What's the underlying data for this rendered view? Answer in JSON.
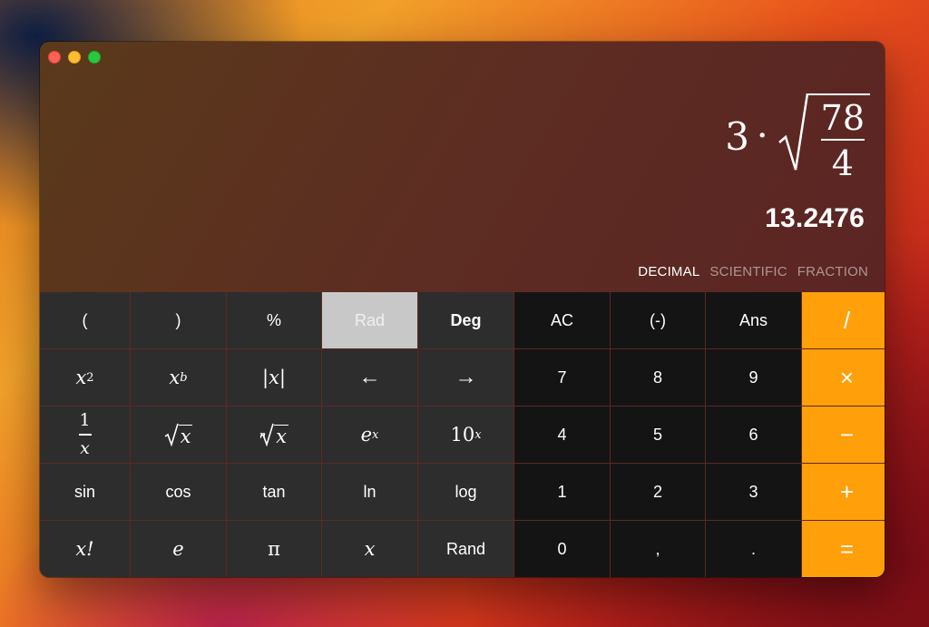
{
  "window": {
    "buttons": [
      "close",
      "minimize",
      "zoom"
    ]
  },
  "display": {
    "expression": {
      "coefficient": "3",
      "operator": "·",
      "numerator": "78",
      "denominator": "4"
    },
    "result": "13.2476",
    "modes": [
      {
        "label": "DECIMAL",
        "active": true
      },
      {
        "label": "SCIENTIFIC",
        "active": false
      },
      {
        "label": "FRACTION",
        "active": false
      }
    ]
  },
  "keys": {
    "lparen": "(",
    "rparen": ")",
    "percent": "%",
    "rad": "Rad",
    "deg": "Deg",
    "ac": "AC",
    "negate": "(-)",
    "ans": "Ans",
    "divide": "/",
    "x_base": "x",
    "sq_exp": "2",
    "pow_exp": "b",
    "abs": "|x|",
    "left_arrow": "←",
    "right_arrow": "→",
    "seven": "7",
    "eight": "8",
    "nine": "9",
    "multiply": "×",
    "one_over_num": "1",
    "one_over_den": "x",
    "sqrt_arg": "x",
    "nroot_index": "n",
    "nroot_arg": "x",
    "exp_base": "e",
    "exp_exp": "x",
    "pow10_base": "10",
    "pow10_exp": "x",
    "four": "4",
    "five": "5",
    "six": "6",
    "minus": "−",
    "sin": "sin",
    "cos": "cos",
    "tan": "tan",
    "ln": "ln",
    "log": "log",
    "one": "1",
    "two": "2",
    "three": "3",
    "plus": "+",
    "factorial": "x!",
    "euler": "e",
    "pi": "π",
    "variable": "x",
    "rand": "Rand",
    "zero": "0",
    "comma": ",",
    "decimal_point": ".",
    "equals": "="
  },
  "colors": {
    "operator_key": "#ff9f0a",
    "function_key": "#2d2d2d",
    "number_key": "#141414",
    "selected_key": "#c8c8c8"
  }
}
